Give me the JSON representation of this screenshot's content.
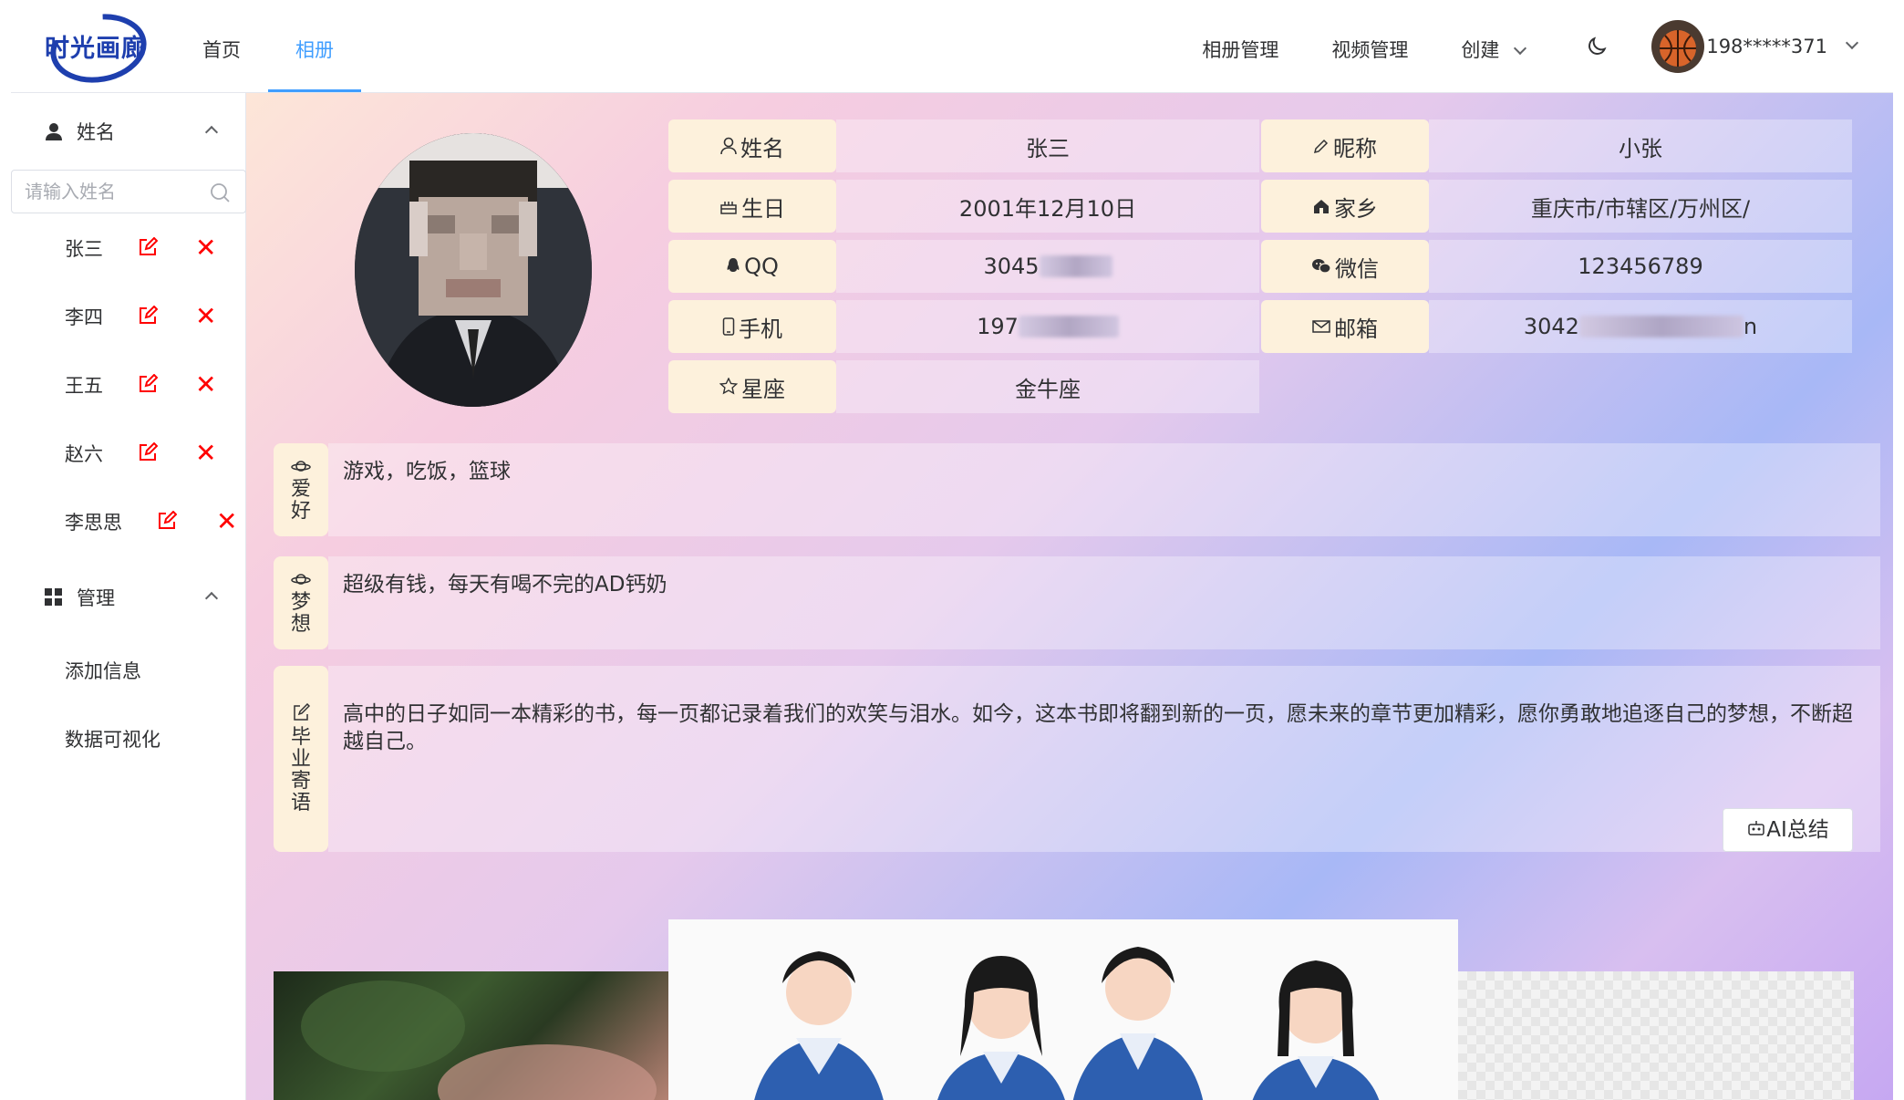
{
  "app": {
    "logo_text": "时光画廊"
  },
  "nav": {
    "home": "首页",
    "album": "相册"
  },
  "nav_right": {
    "album_manage": "相册管理",
    "video_manage": "视频管理",
    "create": "创建",
    "username": "198*****371"
  },
  "sidebar": {
    "name_menu": "姓名",
    "search_placeholder": "请输入姓名",
    "names": [
      "张三",
      "李四",
      "王五",
      "赵六",
      "李思思"
    ],
    "manage_menu": "管理",
    "manage_items": [
      "添加信息",
      "数据可视化"
    ]
  },
  "profile": {
    "labels": {
      "name": "姓名",
      "nickname": "昵称",
      "birthday": "生日",
      "hometown": "家乡",
      "qq": "QQ",
      "wechat": "微信",
      "phone": "手机",
      "email": "邮箱",
      "zodiac": "星座"
    },
    "values": {
      "name": "张三",
      "nickname": "小张",
      "birthday": "2001年12月10日",
      "hometown": "重庆市/市辖区/万州区/",
      "qq": "3045",
      "wechat": "123456789",
      "phone": "197",
      "email": "3042",
      "email_tail": "n",
      "zodiac": "金牛座"
    }
  },
  "blocks": {
    "hobby_tag": [
      "爱",
      "好"
    ],
    "hobby": "游戏，吃饭，篮球",
    "dream_tag": [
      "梦",
      "想"
    ],
    "dream": "超级有钱，每天有喝不完的AD钙奶",
    "message_tag": [
      "毕",
      "业",
      "寄",
      "语"
    ],
    "message": "高中的日子如同一本精彩的书，每一页都记录着我们的欢笑与泪水。如今，这本书即将翻到新的一页，愿未来的章节更加精彩，愿你勇敢地追逐自己的梦想，不断超越自己。",
    "ai_button": "AI总结"
  },
  "colors": {
    "accent": "#409eff",
    "label_bg": "#fdf1dc",
    "delete_red": "#ff0000",
    "logo_blue": "#1e3fae"
  }
}
